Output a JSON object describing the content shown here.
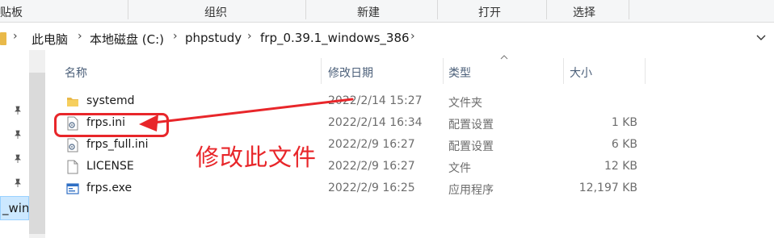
{
  "ribbon": {
    "groups": [
      "贴板",
      "组织",
      "新建",
      "打开",
      "选择"
    ]
  },
  "address": {
    "crumbs": [
      "此电脑",
      "本地磁盘 (C:)",
      "phpstudy",
      "frp_0.39.1_windows_386"
    ],
    "separator": "›"
  },
  "nav": {
    "selected_label": "_windo"
  },
  "columns": {
    "name": "名称",
    "modified": "修改日期",
    "type": "类型",
    "size": "大小"
  },
  "files": [
    {
      "name": "systemd",
      "modified": "2022/2/14 15:27",
      "type": "文件夹",
      "size": "",
      "icon": "folder-icon"
    },
    {
      "name": "frps.ini",
      "modified": "2022/2/14 16:34",
      "type": "配置设置",
      "size": "1 KB",
      "icon": "config-file-icon"
    },
    {
      "name": "frps_full.ini",
      "modified": "2022/2/9 16:27",
      "type": "配置设置",
      "size": "6 KB",
      "icon": "config-file-icon"
    },
    {
      "name": "LICENSE",
      "modified": "2022/2/9 16:27",
      "type": "文件",
      "size": "12 KB",
      "icon": "blank-file-icon"
    },
    {
      "name": "frps.exe",
      "modified": "2022/2/9 16:25",
      "type": "应用程序",
      "size": "12,197 KB",
      "icon": "exe-file-icon"
    }
  ],
  "annotation": {
    "text": "修改此文件",
    "color": "#e8262a"
  },
  "colors": {
    "folder": "#e9b949",
    "selection": "#cce8ff",
    "header_text": "#4c607a"
  }
}
